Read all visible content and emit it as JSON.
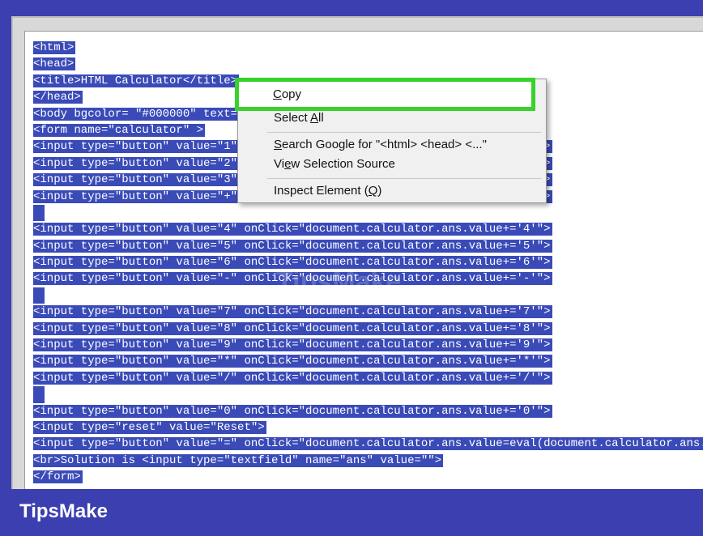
{
  "code_lines": [
    "<html>",
    "<head>",
    "<title>HTML Calculator</title>",
    "</head>",
    "<body bgcolor= \"#000000\" text= \"gold\">",
    "<form name=\"calculator\" >",
    "<input type=\"button\" value=\"1\" onClick=\"document.calculator.ans.value+='1'\">",
    "<input type=\"button\" value=\"2\" onClick=\"document.calculator.ans.value+='2'\">",
    "<input type=\"button\" value=\"3\" onClick=\"document.calculator.ans.value+='3'\">",
    "<input type=\"button\" value=\"+\" onClick=\"document.calculator.ans.value+='+'\">",
    "",
    "<input type=\"button\" value=\"4\" onClick=\"document.calculator.ans.value+='4'\">",
    "<input type=\"button\" value=\"5\" onClick=\"document.calculator.ans.value+='5'\">",
    "<input type=\"button\" value=\"6\" onClick=\"document.calculator.ans.value+='6'\">",
    "<input type=\"button\" value=\"-\" onClick=\"document.calculator.ans.value+='-'\">",
    "",
    "<input type=\"button\" value=\"7\" onClick=\"document.calculator.ans.value+='7'\">",
    "<input type=\"button\" value=\"8\" onClick=\"document.calculator.ans.value+='8'\">",
    "<input type=\"button\" value=\"9\" onClick=\"document.calculator.ans.value+='9'\">",
    "<input type=\"button\" value=\"*\" onClick=\"document.calculator.ans.value+='*'\">",
    "<input type=\"button\" value=\"/\" onClick=\"document.calculator.ans.value+='/'\">",
    "",
    "<input type=\"button\" value=\"0\" onClick=\"document.calculator.ans.value+='0'\">",
    "<input type=\"reset\" value=\"Reset\">",
    "<input type=\"button\" value=\"=\" onClick=\"document.calculator.ans.value=eval(document.calculator.ans.value)\">",
    "<br>Solution is <input type=\"textfield\" name=\"ans\" value=\"\">",
    "</form>"
  ],
  "context_menu": {
    "items": [
      {
        "pre": "",
        "u": "C",
        "post": "opy"
      },
      {
        "pre": "Select ",
        "u": "A",
        "post": "ll"
      },
      {
        "pre": "",
        "u": "S",
        "post": "earch Google for \"<html> <head> <...\""
      },
      {
        "pre": "Vi",
        "u": "e",
        "post": "w Selection Source"
      },
      {
        "pre": "Inspect Element (",
        "u": "Q",
        "post": ")"
      }
    ]
  },
  "watermark": "TipsMake",
  "footer": {
    "brand": "TipsMake"
  },
  "colors": {
    "selection": "#3a4bb8",
    "highlight": "#37d22b",
    "footer": "#3b3fb0"
  }
}
